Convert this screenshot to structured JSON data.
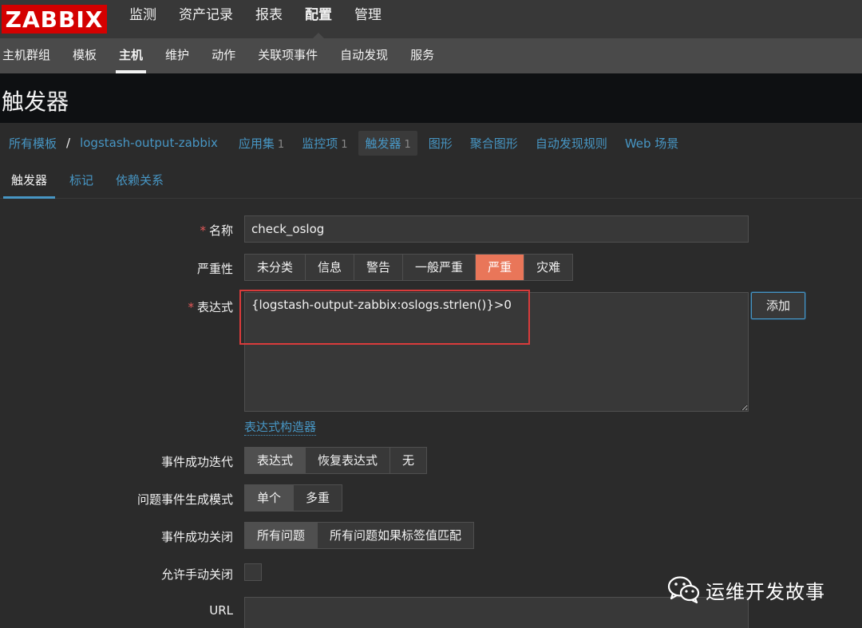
{
  "brand": {
    "logo": "ZABBIX"
  },
  "top_nav": [
    "监测",
    "资产记录",
    "报表",
    "配置",
    "管理"
  ],
  "top_nav_active": "配置",
  "sub_nav": [
    "主机群组",
    "模板",
    "主机",
    "维护",
    "动作",
    "关联项事件",
    "自动发现",
    "服务"
  ],
  "sub_nav_active": "主机",
  "page_title": "触发器",
  "breadcrumb": {
    "root": "所有模板",
    "separator": "/",
    "template": "logstash-output-zabbix",
    "items": [
      {
        "label": "应用集",
        "count": "1"
      },
      {
        "label": "监控项",
        "count": "1"
      },
      {
        "label": "触发器",
        "count": "1"
      },
      {
        "label": "图形"
      },
      {
        "label": "聚合图形"
      },
      {
        "label": "自动发现规则"
      },
      {
        "label": "Web 场景"
      }
    ]
  },
  "tabs": [
    "触发器",
    "标记",
    "依赖关系"
  ],
  "form": {
    "name": {
      "label": "名称",
      "value": "check_oslog",
      "required": true
    },
    "severity": {
      "label": "严重性",
      "options": [
        "未分类",
        "信息",
        "警告",
        "一般严重",
        "严重",
        "灾难"
      ],
      "selected": "严重"
    },
    "expression": {
      "label": "表达式",
      "value": "{logstash-output-zabbix:oslogs.strlen()}>0",
      "required": true,
      "add_button": "添加",
      "builder_link": "表达式构造器"
    },
    "ok_event_generation": {
      "label": "事件成功迭代",
      "options": [
        "表达式",
        "恢复表达式",
        "无"
      ],
      "selected": "表达式"
    },
    "problem_event_mode": {
      "label": "问题事件生成模式",
      "options": [
        "单个",
        "多重"
      ],
      "selected": "单个"
    },
    "ok_event_closes": {
      "label": "事件成功关闭",
      "options": [
        "所有问题",
        "所有问题如果标签值匹配"
      ],
      "selected": "所有问题"
    },
    "manual_close": {
      "label": "允许手动关闭",
      "checked": false
    },
    "url": {
      "label": "URL",
      "value": ""
    }
  },
  "watermark": {
    "text": "运维开发故事"
  },
  "colors": {
    "accent": "#4796c4",
    "severity_high": "#e97659",
    "logo": "#d40000",
    "highlight": "#d93b3b"
  }
}
